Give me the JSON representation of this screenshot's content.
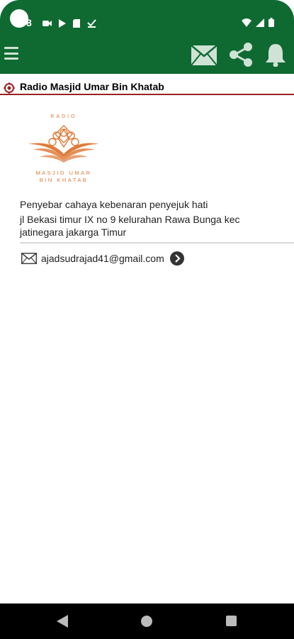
{
  "status_bar": {
    "time": "8",
    "icons": [
      "video-icon",
      "play-icon",
      "sim-card-icon",
      "download-done-icon",
      "wifi-icon",
      "signal-icon",
      "battery-icon"
    ]
  },
  "app_bar": {
    "icons": [
      "menu-icon",
      "mail-icon",
      "share-icon",
      "bell-icon"
    ]
  },
  "station": {
    "name": "Radio Masjid Umar Bin Khatab",
    "tagline": "Penyebar cahaya kebenaran penyejuk hati",
    "address": "jl Bekasi timur IX no 9 kelurahan Rawa Bunga kec jatinegara jakarga Timur",
    "email": "ajadsudrajad41@gmail.com"
  },
  "logo": {
    "top_text": "RADIO",
    "line1": "MASJID UMAR",
    "line2": "BIN KHATAB",
    "color": "#e07b3a"
  },
  "colors": {
    "brand": "#0f6a32",
    "accent": "#9a2323",
    "logo": "#e07b3a"
  },
  "nav_bar": {
    "icons": [
      "back-icon",
      "home-icon",
      "recent-apps-icon"
    ]
  }
}
